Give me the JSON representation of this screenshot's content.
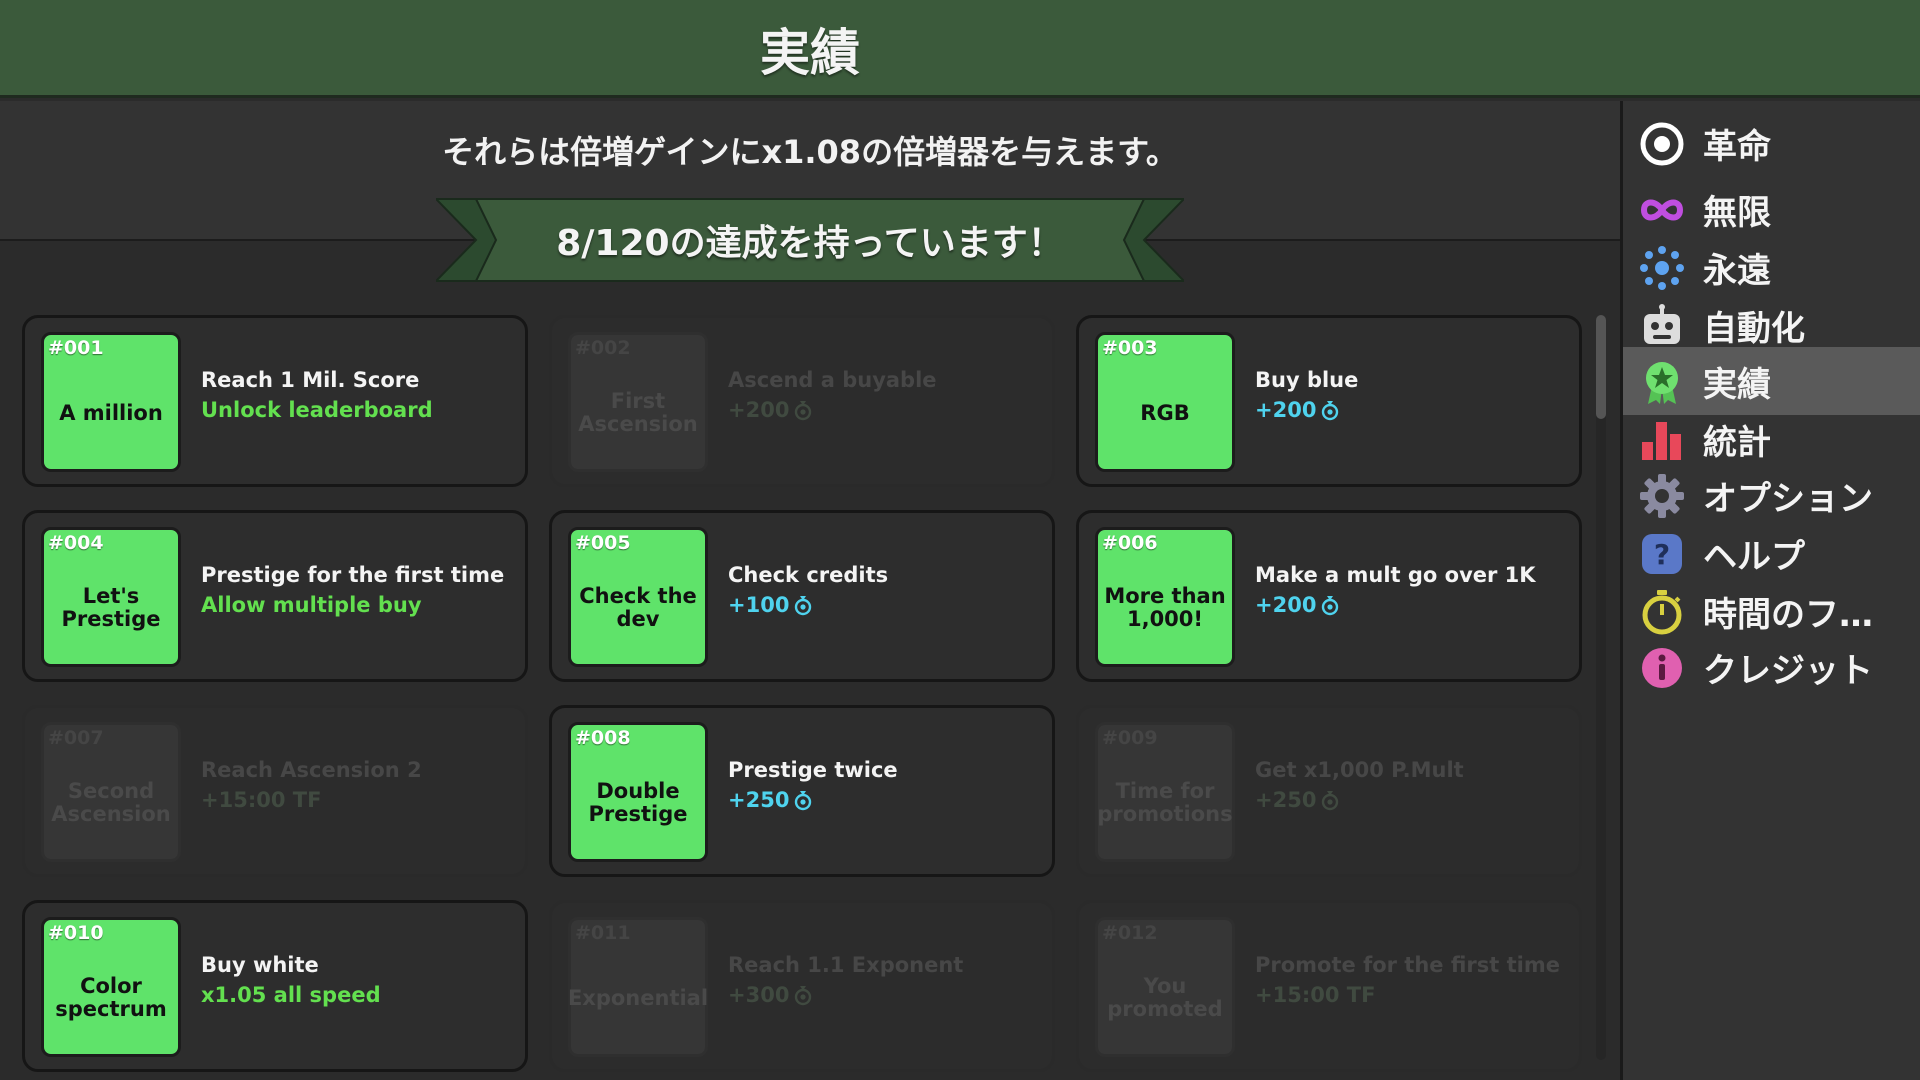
{
  "header": {
    "title": "実績"
  },
  "info": {
    "text": "それらは倍増ゲインにx1.08の倍増器を与えます。"
  },
  "banner": {
    "text": "8/120の達成を持っています！"
  },
  "colors": {
    "accent_green": "#5fe36a",
    "reward_cyan": "#4fd3ee",
    "unlock_green": "#63e04f",
    "header_bg": "#3b5a3b"
  },
  "achievements": [
    {
      "id": "#001",
      "name": "A million",
      "desc": "Reach 1 Mil. Score",
      "reward": "Unlock leaderboard",
      "reward_type": "unlock",
      "unlocked": true
    },
    {
      "id": "#002",
      "name": "First Ascension",
      "desc": "Ascend a buyable",
      "reward": "+200",
      "reward_type": "credits",
      "unlocked": false
    },
    {
      "id": "#003",
      "name": "RGB",
      "desc": "Buy blue",
      "reward": "+200",
      "reward_type": "credits",
      "unlocked": true
    },
    {
      "id": "#004",
      "name": "Let's Prestige",
      "desc": "Prestige for the first time",
      "reward": "Allow multiple buy",
      "reward_type": "unlock",
      "unlocked": true
    },
    {
      "id": "#005",
      "name": "Check the dev",
      "desc": "Check credits",
      "reward": "+100",
      "reward_type": "credits",
      "unlocked": true
    },
    {
      "id": "#006",
      "name": "More than 1,000!",
      "desc": "Make a mult go over 1K",
      "reward": "+200",
      "reward_type": "credits",
      "unlocked": true
    },
    {
      "id": "#007",
      "name": "Second Ascension",
      "desc": "Reach Ascension 2",
      "reward": "+15:00 TF",
      "reward_type": "unlock",
      "unlocked": false
    },
    {
      "id": "#008",
      "name": "Double Prestige",
      "desc": "Prestige twice",
      "reward": "+250",
      "reward_type": "credits",
      "unlocked": true
    },
    {
      "id": "#009",
      "name": "Time for promotions",
      "desc": "Get x1,000 P.Mult",
      "reward": "+250",
      "reward_type": "credits",
      "unlocked": false
    },
    {
      "id": "#010",
      "name": "Color spectrum",
      "desc": "Buy white",
      "reward": "x1.05 all speed",
      "reward_type": "unlock",
      "unlocked": true
    },
    {
      "id": "#011",
      "name": "Exponential",
      "desc": "Reach 1.1 Exponent",
      "reward": "+300",
      "reward_type": "credits",
      "unlocked": false
    },
    {
      "id": "#012",
      "name": "You promoted",
      "desc": "Promote for the first time",
      "reward": "+15:00 TF",
      "reward_type": "unlock",
      "unlocked": false
    }
  ],
  "sidebar": {
    "items": [
      {
        "label": "革命",
        "icon": "target-icon",
        "active": false
      },
      {
        "label": "無限",
        "icon": "infinity-icon",
        "active": false
      },
      {
        "label": "永遠",
        "icon": "sun-dots-icon",
        "active": false
      },
      {
        "label": "自動化",
        "icon": "robot-icon",
        "active": false
      },
      {
        "label": "実績",
        "icon": "medal-icon",
        "active": true
      },
      {
        "label": "統計",
        "icon": "bar-chart-icon",
        "active": false
      },
      {
        "label": "オプション",
        "icon": "gear-icon",
        "active": false
      },
      {
        "label": "ヘルプ",
        "icon": "help-icon",
        "active": false
      },
      {
        "label": "時間のフ…",
        "icon": "stopwatch-icon",
        "active": false
      },
      {
        "label": "クレジット",
        "icon": "info-icon",
        "active": false
      }
    ]
  }
}
